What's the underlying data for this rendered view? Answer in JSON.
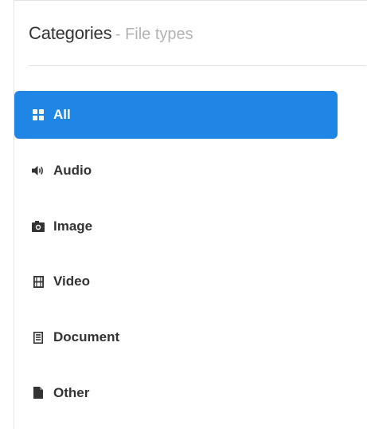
{
  "header": {
    "title": "Categories",
    "subtitle": "- File types"
  },
  "menu": {
    "items": [
      {
        "label": "All",
        "icon": "grid-icon",
        "active": true
      },
      {
        "label": "Audio",
        "icon": "speaker-icon",
        "active": false
      },
      {
        "label": "Image",
        "icon": "camera-icon",
        "active": false
      },
      {
        "label": "Video",
        "icon": "film-icon",
        "active": false
      },
      {
        "label": "Document",
        "icon": "document-icon",
        "active": false
      },
      {
        "label": "Other",
        "icon": "file-icon",
        "active": false
      }
    ]
  },
  "colors": {
    "accent": "#1f86e6",
    "text": "#333333",
    "muted": "#b3b3b3"
  }
}
